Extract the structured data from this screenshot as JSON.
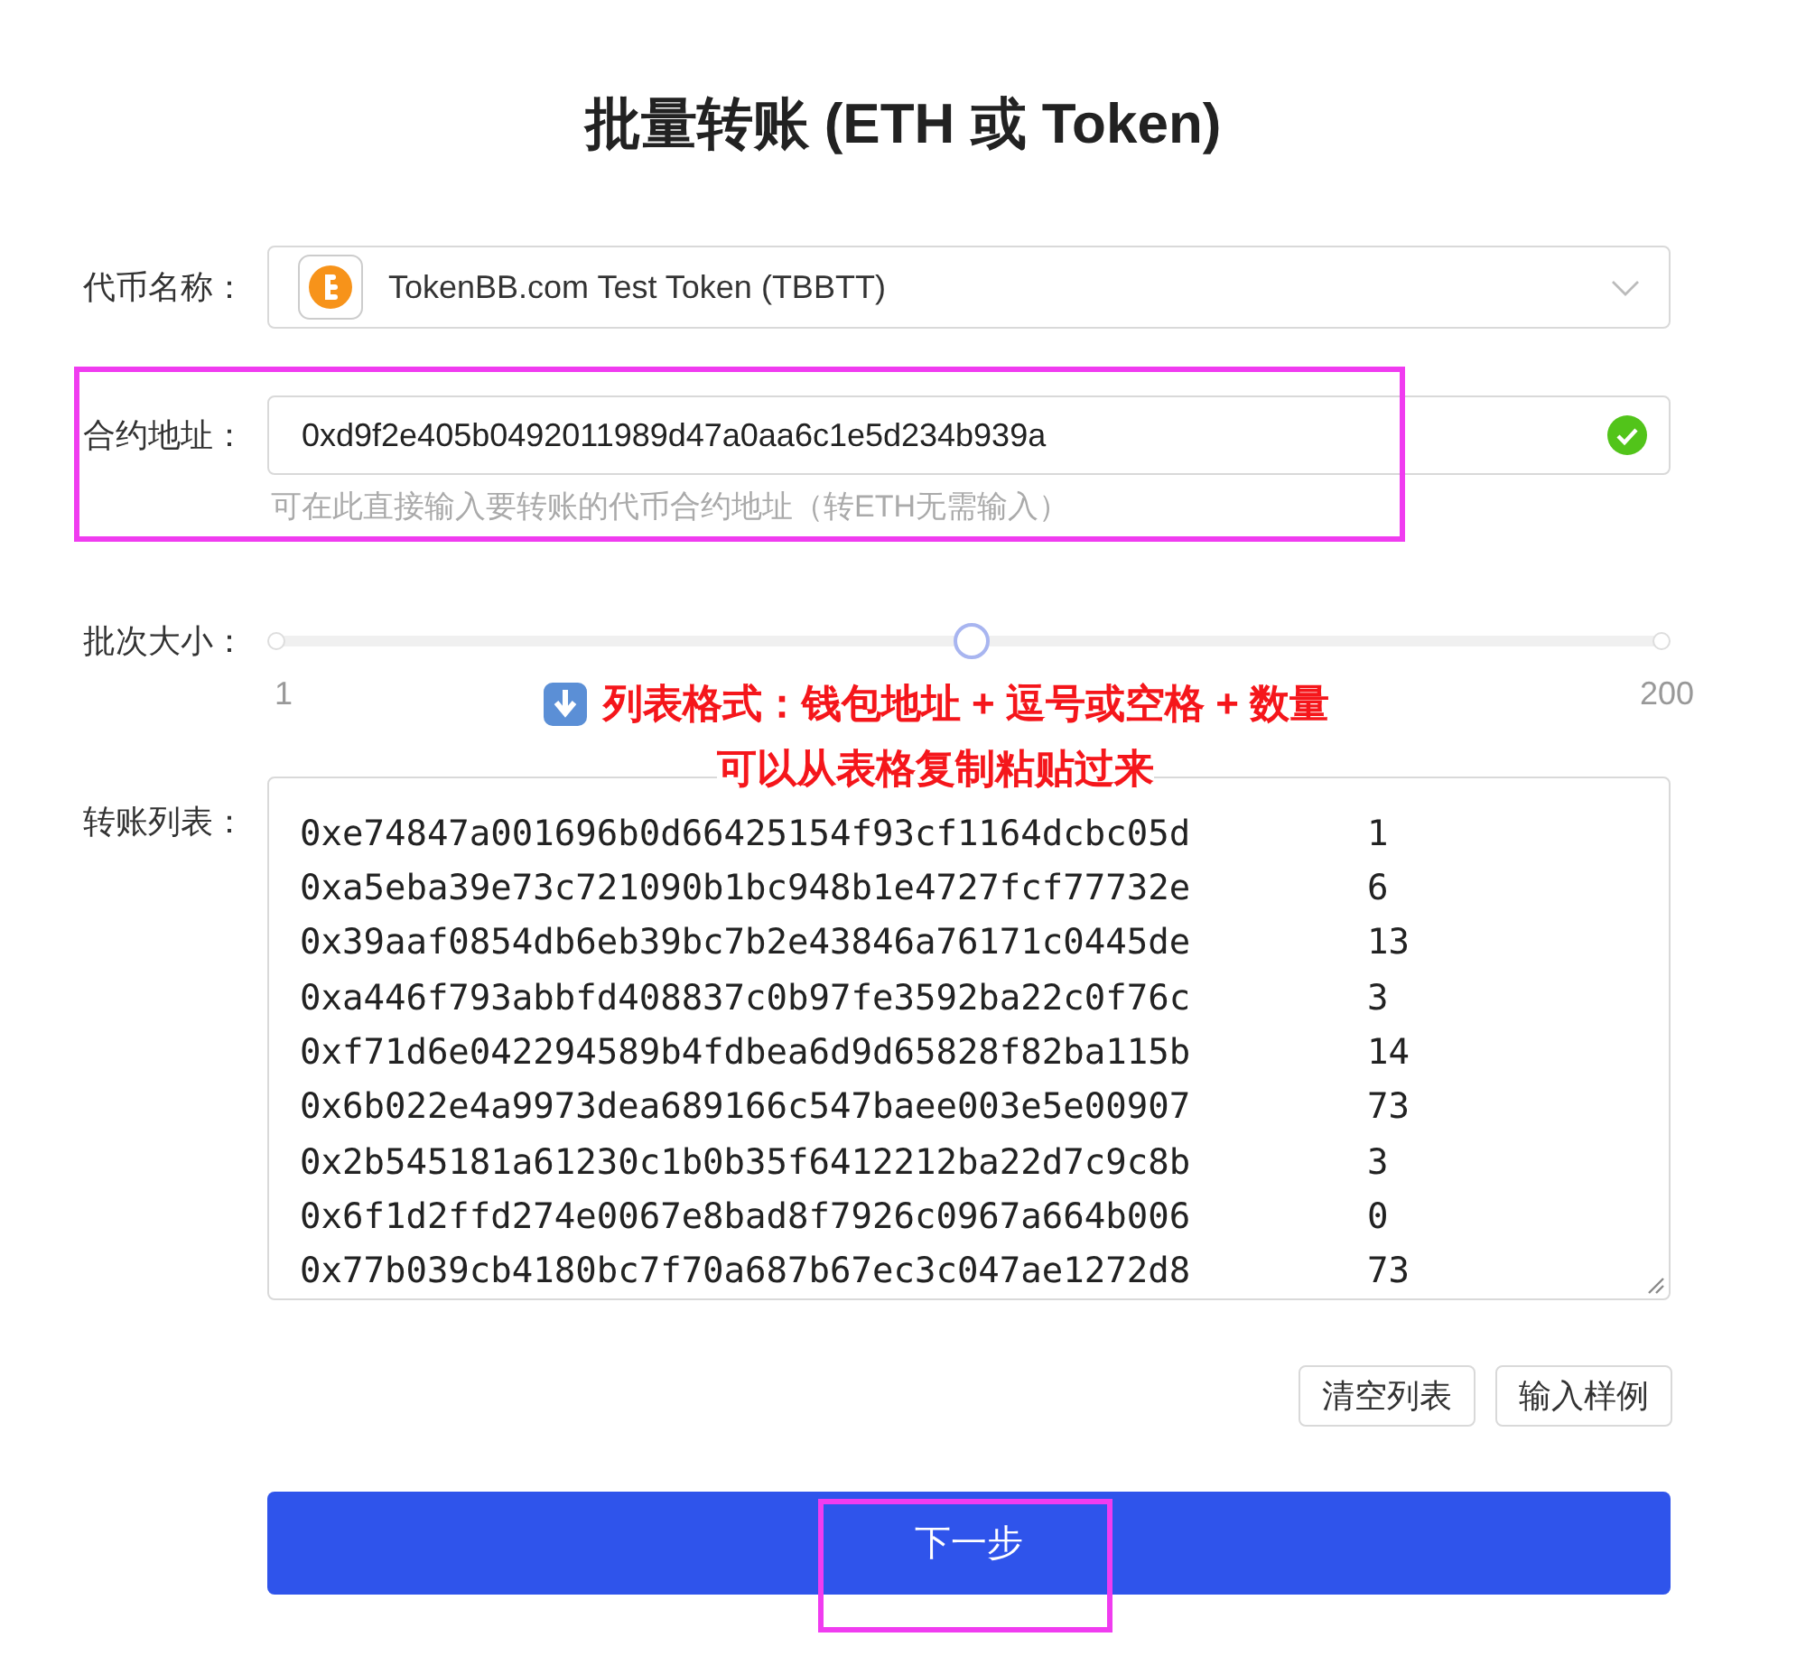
{
  "title": "批量转账 (ETH 或 Token)",
  "token_field": {
    "label": "代币名称：",
    "value": "TokenBB.com Test Token (TBBTT)"
  },
  "contract_field": {
    "label": "合约地址：",
    "value": "0xd9f2e405b0492011989d47a0aa6c1e5d234b939a",
    "valid": true,
    "hint": "可在此直接输入要转账的代币合约地址（转ETH无需输入）"
  },
  "batch_size": {
    "label": "批次大小：",
    "level": 0.5,
    "min_label": "1",
    "max_label": "200"
  },
  "annotation": {
    "lines": [
      "列表格式：钱包地址 + 逗号或空格 + 数量",
      "可以从表格复制粘贴过来"
    ]
  },
  "transfer_list": {
    "label": "转账列表：",
    "rows": [
      {
        "address": "0xe74847a001696b0d66425154f93cf1164dcbc05d",
        "amount": "1"
      },
      {
        "address": "0xa5eba39e73c721090b1bc948b1e4727fcf77732e",
        "amount": "6"
      },
      {
        "address": "0x39aaf0854db6eb39bc7b2e43846a76171c0445de",
        "amount": "13"
      },
      {
        "address": "0xa446f793abbfd408837c0b97fe3592ba22c0f76c",
        "amount": "3"
      },
      {
        "address": "0xf71d6e042294589b4fdbea6d9d65828f82ba115b",
        "amount": "14"
      },
      {
        "address": "0x6b022e4a9973dea689166c547baee003e5e00907",
        "amount": "73"
      },
      {
        "address": "0x2b545181a61230c1b0b35f6412212ba22d7c9c8b",
        "amount": "3"
      },
      {
        "address": "0x6f1d2ffd274e0067e8bad8f7926c0967a664b006",
        "amount": "0"
      },
      {
        "address": "0x77b039cb4180bc7f70a687b67ec3c047ae1272d8",
        "amount": "73"
      }
    ]
  },
  "list_buttons": [
    "清空列表",
    "输入样例"
  ],
  "next_button": "下一步"
}
